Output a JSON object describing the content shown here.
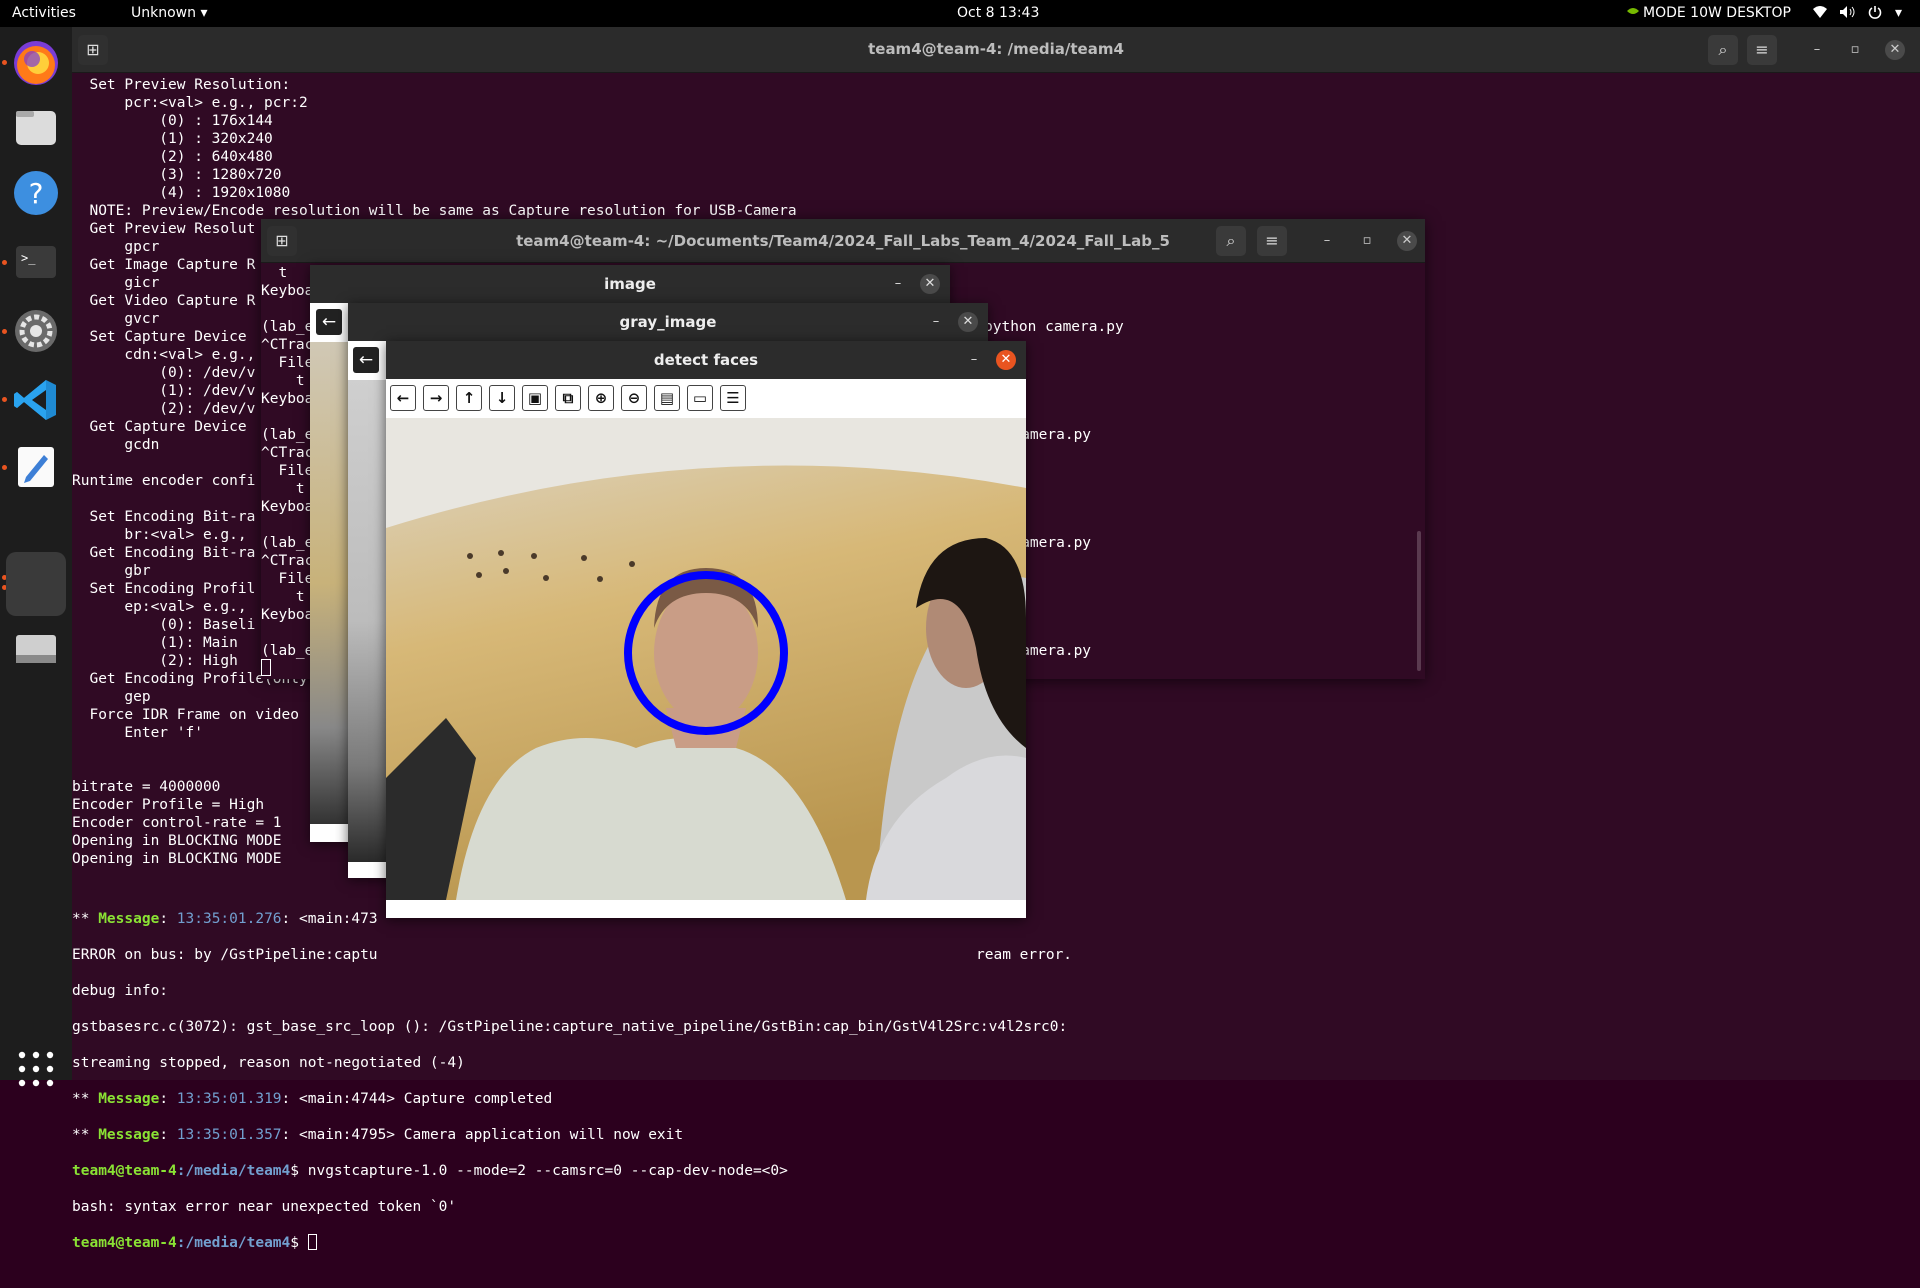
{
  "topbar": {
    "activities": "Activities",
    "app_menu": "Unknown",
    "clock": "Oct 8  13:43",
    "power_mode": "MODE 10W DESKTOP"
  },
  "dock": {
    "items": [
      "firefox-icon",
      "files-icon",
      "help-icon",
      "terminal-icon",
      "settings-icon",
      "vscode-icon",
      "text-editor-icon",
      "active-app-icon",
      "drive-icon"
    ],
    "show_apps": "show-applications-icon"
  },
  "term_main": {
    "title": "team4@team-4: /media/team4",
    "lines_top": [
      "  Set Preview Resolution:",
      "      pcr:<val> e.g., pcr:2",
      "          (0) : 176x144",
      "          (1) : 320x240",
      "          (2) : 640x480",
      "          (3) : 1280x720",
      "          (4) : 1920x1080",
      "  NOTE: Preview/Encode resolution will be same as Capture resolution for USB-Camera",
      "  Get Preview Resolut",
      "      gpcr",
      "  Get Image Capture R",
      "      gicr",
      "  Get Video Capture R",
      "      gvcr",
      "  Set Capture Device",
      "      cdn:<val> e.g.,",
      "          (0): /dev/v",
      "          (1): /dev/v",
      "          (2): /dev/v",
      "  Get Capture Device",
      "      gcdn",
      "",
      "Runtime encoder confi",
      "",
      "  Set Encoding Bit-ra",
      "      br:<val> e.g.,",
      "  Get Encoding Bit-ra",
      "      gbr",
      "  Set Encoding Profil",
      "      ep:<val> e.g.,",
      "          (0): Baseli",
      "          (1): Main",
      "          (2): High",
      "  Get Encoding Profile(only",
      "      gep",
      "  Force IDR Frame on video",
      "      Enter 'f'",
      "",
      "",
      "bitrate = 4000000",
      "Encoder Profile = High",
      "Encoder control-rate = 1",
      "Opening in BLOCKING MODE",
      "Opening in BLOCKING MODE"
    ],
    "msg1_prefix": "** ",
    "msg_word": "Message",
    "msg1_time": "13:35:01.276",
    "msg1_rest": ": <main:473",
    "error_line": "ERROR on bus: by /GstPipeline:captu",
    "error_tail": "ream error.",
    "debug_line": "debug info:",
    "gst_line": "gstbasesrc.c(3072): gst_base_src_loop (): /GstPipeline:capture_native_pipeline/GstBin:cap_bin/GstV4l2Src:v4l2src0:",
    "stream_line": "streaming stopped, reason not-negotiated (-4)",
    "msg2_time": "13:35:01.319",
    "msg2_rest": ": <main:4744> Capture completed",
    "msg3_time": "13:35:01.357",
    "msg3_rest": ": <main:4795> Camera application will now exit",
    "prompt_user": "team4@team-4",
    "prompt_path": ":/media/team4",
    "prompt_dollar": "$ ",
    "cmd1": "nvgstcapture-1.0 --mode=2 --camsrc=0 --cap-dev-node=<0>",
    "bash_err": "bash: syntax error near unexpected token `0'"
  },
  "term2": {
    "title": "team4@team-4: ~/Documents/Team4/2024_Fall_Labs_Team_4/2024_Fall_Lab_5",
    "left_lines": [
      "  t",
      "Keyboa",
      "",
      "(lab_e",
      "^CTrac",
      "  File",
      "    t",
      "Keyboa",
      "",
      "(lab_e",
      "^CTrac",
      "  File",
      "    t",
      "Keyboa",
      "",
      "(lab_e",
      "^CTrac",
      "  File",
      "    t",
      "Keyboa",
      "",
      "(lab_e"
    ],
    "right_lines": [
      "python camera.py",
      "n camera.py",
      "n camera.py",
      "n camera.py"
    ]
  },
  "cv_image": {
    "title": "image"
  },
  "cv_gray": {
    "title": "gray_image"
  },
  "cv_faces": {
    "title": "detect faces",
    "toolbar": [
      "pan-left",
      "pan-right",
      "pan-up",
      "pan-down",
      "zoom-in-image",
      "zoom-fit",
      "zoom-in",
      "zoom-out",
      "save-image",
      "copy-clipboard",
      "properties"
    ]
  },
  "colors": {
    "accent": "#e95420",
    "face_circle": "#0000ff",
    "term_bg": "#300a24"
  }
}
